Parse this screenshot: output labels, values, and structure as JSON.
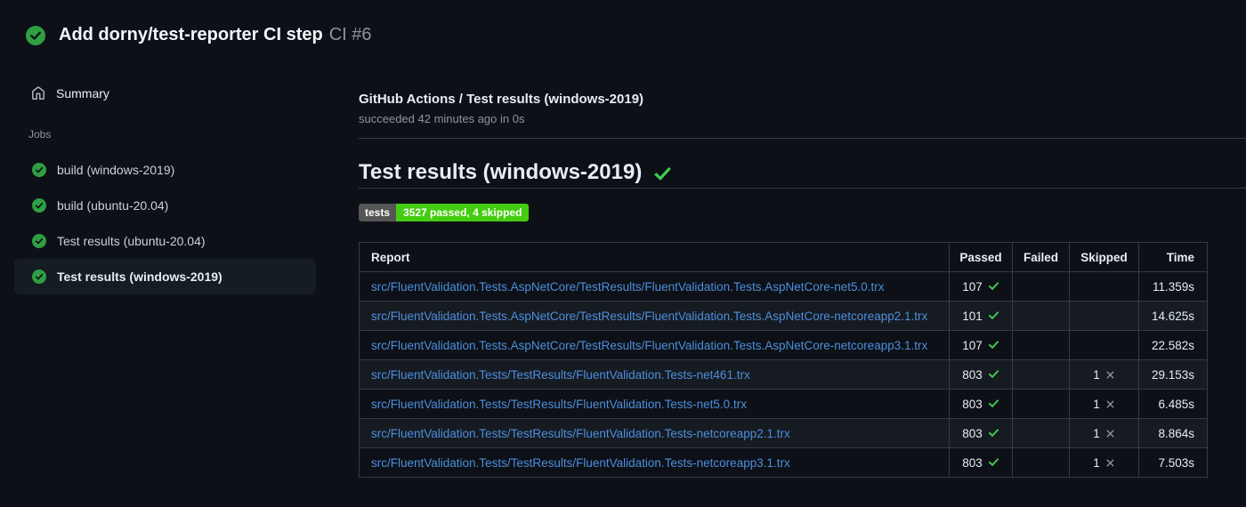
{
  "header": {
    "title": "Add dorny/test-reporter CI step",
    "run_number": "CI #6"
  },
  "sidebar": {
    "summary_label": "Summary",
    "jobs_label": "Jobs",
    "jobs": [
      {
        "label": "build (windows-2019)",
        "status": "success",
        "selected": false
      },
      {
        "label": "build (ubuntu-20.04)",
        "status": "success",
        "selected": false
      },
      {
        "label": "Test results (ubuntu-20.04)",
        "status": "success",
        "selected": false
      },
      {
        "label": "Test results (windows-2019)",
        "status": "success",
        "selected": true
      }
    ]
  },
  "main": {
    "breadcrumb": "GitHub Actions / Test results (windows-2019)",
    "status_line": "succeeded 42 minutes ago in 0s",
    "section_title": "Test results (windows-2019)",
    "badge": {
      "label": "tests",
      "value": "3527 passed, 4 skipped"
    },
    "table": {
      "columns": [
        "Report",
        "Passed",
        "Failed",
        "Skipped",
        "Time"
      ],
      "rows": [
        {
          "report": "src/FluentValidation.Tests.AspNetCore/TestResults/FluentValidation.Tests.AspNetCore-net5.0.trx",
          "passed": "107",
          "failed": "",
          "skipped": "",
          "time": "11.359s"
        },
        {
          "report": "src/FluentValidation.Tests.AspNetCore/TestResults/FluentValidation.Tests.AspNetCore-netcoreapp2.1.trx",
          "passed": "101",
          "failed": "",
          "skipped": "",
          "time": "14.625s"
        },
        {
          "report": "src/FluentValidation.Tests.AspNetCore/TestResults/FluentValidation.Tests.AspNetCore-netcoreapp3.1.trx",
          "passed": "107",
          "failed": "",
          "skipped": "",
          "time": "22.582s"
        },
        {
          "report": "src/FluentValidation.Tests/TestResults/FluentValidation.Tests-net461.trx",
          "passed": "803",
          "failed": "",
          "skipped": "1",
          "time": "29.153s"
        },
        {
          "report": "src/FluentValidation.Tests/TestResults/FluentValidation.Tests-net5.0.trx",
          "passed": "803",
          "failed": "",
          "skipped": "1",
          "time": "6.485s"
        },
        {
          "report": "src/FluentValidation.Tests/TestResults/FluentValidation.Tests-netcoreapp2.1.trx",
          "passed": "803",
          "failed": "",
          "skipped": "1",
          "time": "8.864s"
        },
        {
          "report": "src/FluentValidation.Tests/TestResults/FluentValidation.Tests-netcoreapp3.1.trx",
          "passed": "803",
          "failed": "",
          "skipped": "1",
          "time": "7.503s"
        }
      ]
    }
  },
  "colors": {
    "page_bg": "#0d1117",
    "success_green": "#2ea043",
    "check_green": "#3fcf50",
    "skipped_x": "#9aa2ab",
    "link_blue": "#4d8edd",
    "muted_text": "#8b949e",
    "border": "#343b44",
    "row_alt_bg": "#161b22",
    "selected_bg": "#161c23",
    "badge_label_bg": "#555555",
    "badge_value_bg": "#44cc11"
  }
}
